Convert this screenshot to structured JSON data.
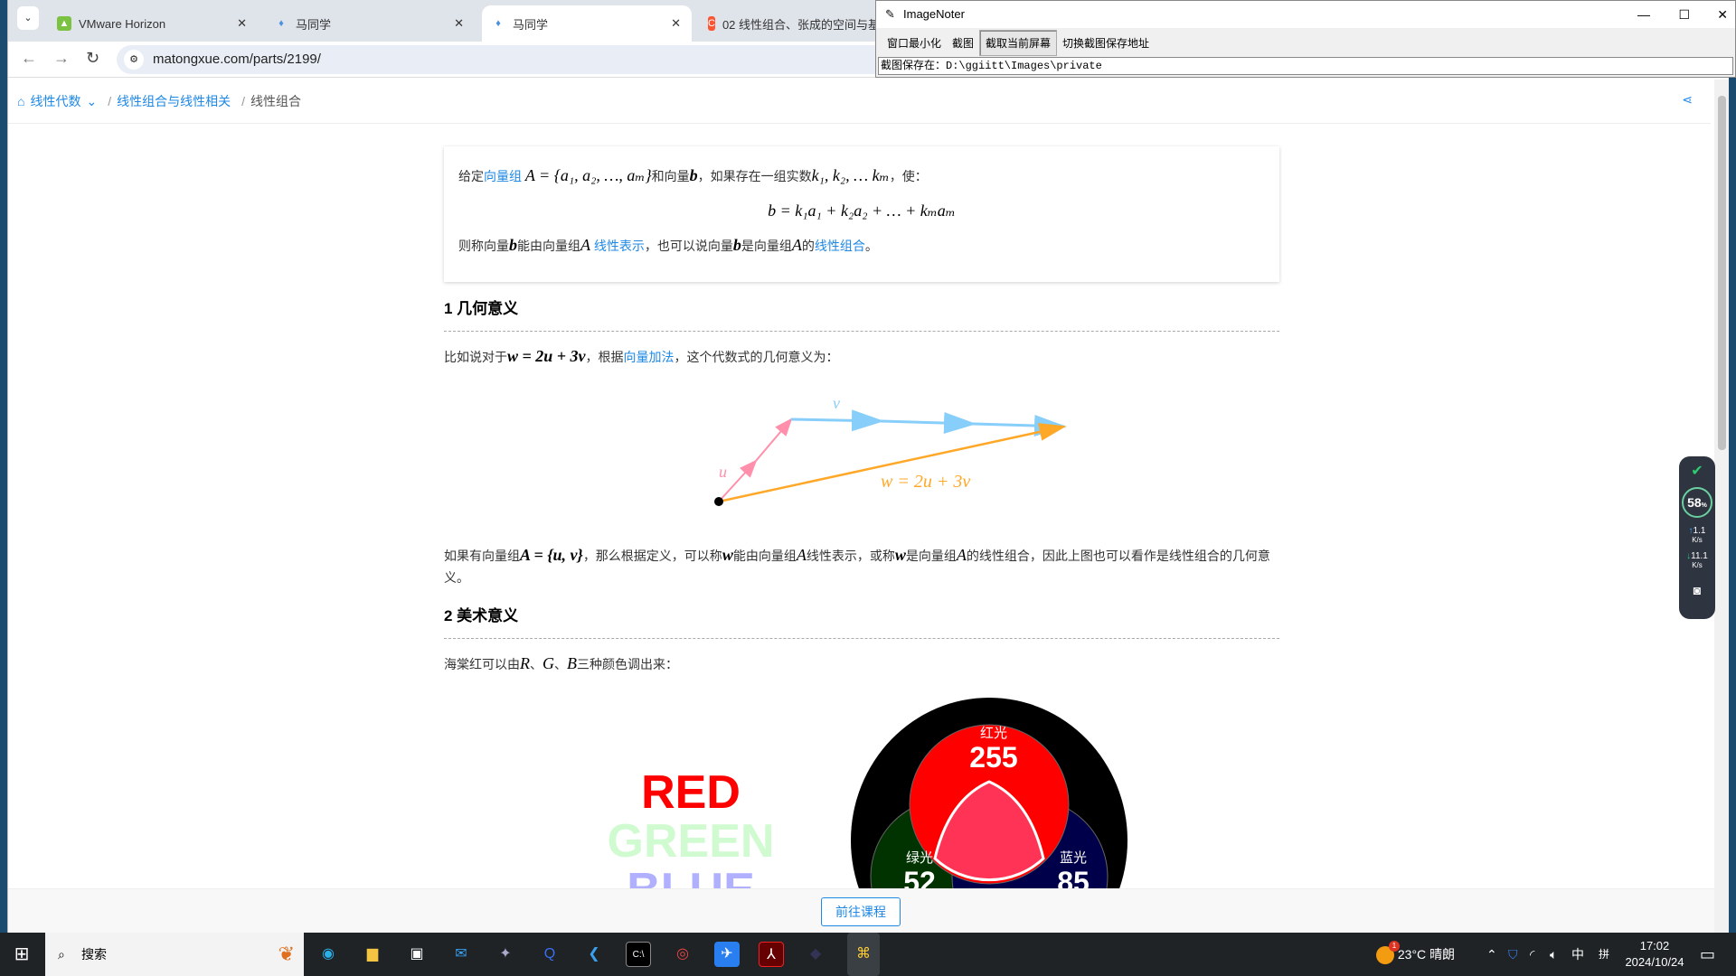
{
  "browser": {
    "tabs": [
      {
        "title": "VMware Horizon",
        "icon": "vmware-icon"
      },
      {
        "title": "马同学",
        "icon": "matongxue-icon"
      },
      {
        "title": "马同学",
        "icon": "matongxue-icon",
        "active": true
      },
      {
        "title": "02 线性组合、张成的空间与基",
        "icon": "csdn-icon"
      }
    ],
    "url": "matongxue.com/parts/2199/"
  },
  "imagenoter": {
    "title": "ImageNoter",
    "menu": [
      "窗口最小化",
      "截图",
      "截取当前屏幕",
      "切换截图保存地址"
    ],
    "path": "截图保存在：D:\\ggiitt\\Images\\private"
  },
  "breadcrumb": {
    "items": [
      "线性代数",
      "线性组合与线性相关"
    ],
    "current": "线性组合"
  },
  "card": {
    "l1": [
      "给定",
      "向量组",
      "A = {a₁, a₂, …, aₘ}",
      "和向量",
      "b",
      "，如果存在一组实数",
      "k₁, k₂, … kₘ",
      "，使："
    ],
    "formula": "b = k₁a₁ + k₂a₂ + … + kₘaₘ",
    "l3": [
      "则称向量",
      "b",
      "能由向量组",
      "A",
      "线性表示",
      "，也可以说向量",
      "b",
      "是向量组",
      "A",
      "的",
      "线性组合",
      "。"
    ]
  },
  "section1": {
    "heading": "1 几何意义",
    "p1": [
      "比如说对于",
      "w = 2u + 3v",
      "，根据",
      "向量加法",
      "，这个代数式的几何意义为："
    ],
    "diagram": {
      "u": "u",
      "v": "v",
      "w": "w = 2u + 3v",
      "colors": {
        "u": "#ff8fab",
        "v": "#87cefa",
        "w": "#ffa726"
      }
    },
    "p2": [
      "如果有向量组",
      "A = {u, v}",
      "，那么根据定义，可以称",
      "w",
      "能由向量组",
      "A",
      "线性表示，或称",
      "w",
      "是向量组",
      "A",
      "的线性组合，因此上图也可以看作是线性组合的几何意义。"
    ]
  },
  "section2": {
    "heading": "2 美术意义",
    "p1": [
      "海棠红可以由",
      "R",
      "、",
      "G",
      "、",
      "B",
      "三种颜色调出来："
    ],
    "rgb": {
      "words": [
        "RED",
        "GREEN",
        "BLUE"
      ],
      "red_label": "红光",
      "red": "255",
      "green_label": "绿光",
      "green": "52",
      "blue_label": "蓝光",
      "blue": "85"
    }
  },
  "bottom": {
    "button": "前往课程"
  },
  "widget": {
    "percent": "58",
    "pct_sign": "%",
    "up": "1.1",
    "down": "11.1",
    "unit": "K/s"
  },
  "taskbar": {
    "search": "搜索",
    "weather": "23°C",
    "weather_text": "晴朗",
    "badge": "1",
    "ime": "中",
    "ime2": "拼",
    "time": "17:02",
    "date": "2024/10/24"
  }
}
